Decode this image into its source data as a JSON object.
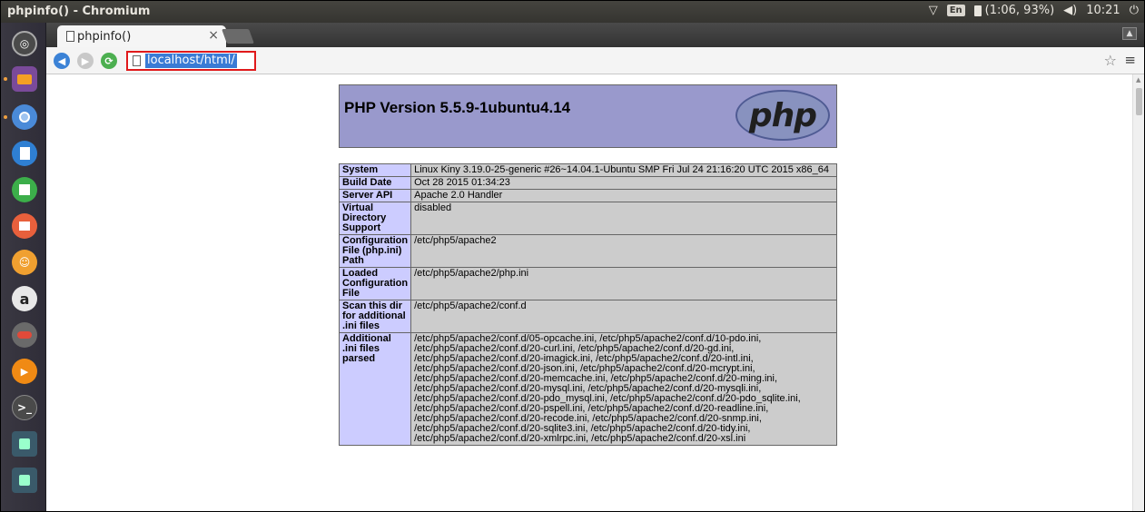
{
  "window": {
    "title": "phpinfo() - Chromium"
  },
  "panel": {
    "keyboard": "En",
    "battery": "(1:06, 93%)",
    "time": "10:21"
  },
  "browser": {
    "tab_title": "phpinfo()",
    "tab_close": "×",
    "url": "localhost/html/"
  },
  "php": {
    "version_title": "PHP Version 5.5.9-1ubuntu4.14",
    "logo_text": "php",
    "rows": [
      {
        "key": "System",
        "value": "Linux Kiny 3.19.0-25-generic #26~14.04.1-Ubuntu SMP Fri Jul 24 21:16:20 UTC 2015 x86_64"
      },
      {
        "key": "Build Date",
        "value": "Oct 28 2015 01:34:23"
      },
      {
        "key": "Server API",
        "value": "Apache 2.0 Handler"
      },
      {
        "key": "Virtual Directory Support",
        "value": "disabled"
      },
      {
        "key": "Configuration File (php.ini) Path",
        "value": "/etc/php5/apache2"
      },
      {
        "key": "Loaded Configuration File",
        "value": "/etc/php5/apache2/php.ini"
      },
      {
        "key": "Scan this dir for additional .ini files",
        "value": "/etc/php5/apache2/conf.d"
      },
      {
        "key": "Additional .ini files parsed",
        "value": "/etc/php5/apache2/conf.d/05-opcache.ini, /etc/php5/apache2/conf.d/10-pdo.ini, /etc/php5/apache2/conf.d/20-curl.ini, /etc/php5/apache2/conf.d/20-gd.ini, /etc/php5/apache2/conf.d/20-imagick.ini, /etc/php5/apache2/conf.d/20-intl.ini, /etc/php5/apache2/conf.d/20-json.ini, /etc/php5/apache2/conf.d/20-mcrypt.ini, /etc/php5/apache2/conf.d/20-memcache.ini, /etc/php5/apache2/conf.d/20-ming.ini, /etc/php5/apache2/conf.d/20-mysql.ini, /etc/php5/apache2/conf.d/20-mysqli.ini, /etc/php5/apache2/conf.d/20-pdo_mysql.ini, /etc/php5/apache2/conf.d/20-pdo_sqlite.ini, /etc/php5/apache2/conf.d/20-pspell.ini, /etc/php5/apache2/conf.d/20-readline.ini, /etc/php5/apache2/conf.d/20-recode.ini, /etc/php5/apache2/conf.d/20-snmp.ini, /etc/php5/apache2/conf.d/20-sqlite3.ini, /etc/php5/apache2/conf.d/20-tidy.ini, /etc/php5/apache2/conf.d/20-xmlrpc.ini, /etc/php5/apache2/conf.d/20-xsl.ini"
      }
    ]
  },
  "launcher": {
    "items": [
      {
        "icon": "ubuntu-dash-icon",
        "color": "#4a4a4a"
      },
      {
        "icon": "files-icon",
        "color": "#f4a024"
      },
      {
        "icon": "chromium-icon",
        "color": "#3d8fd6"
      },
      {
        "icon": "libreoffice-writer-icon",
        "color": "#2f7fd2"
      },
      {
        "icon": "libreoffice-calc-icon",
        "color": "#3cae4a"
      },
      {
        "icon": "libreoffice-impress-icon",
        "color": "#e8603c"
      },
      {
        "icon": "software-center-icon",
        "color": "#f0a030"
      },
      {
        "icon": "amazon-icon",
        "color": "#e8e8e8"
      },
      {
        "icon": "system-settings-icon",
        "color": "#d04040"
      },
      {
        "icon": "vlc-icon",
        "color": "#f08a14"
      },
      {
        "icon": "terminal-icon",
        "color": "#3a3a3a"
      },
      {
        "icon": "scanner-icon",
        "color": "#3a5a6a"
      },
      {
        "icon": "scanner-icon-2",
        "color": "#3a5a6a"
      }
    ]
  }
}
